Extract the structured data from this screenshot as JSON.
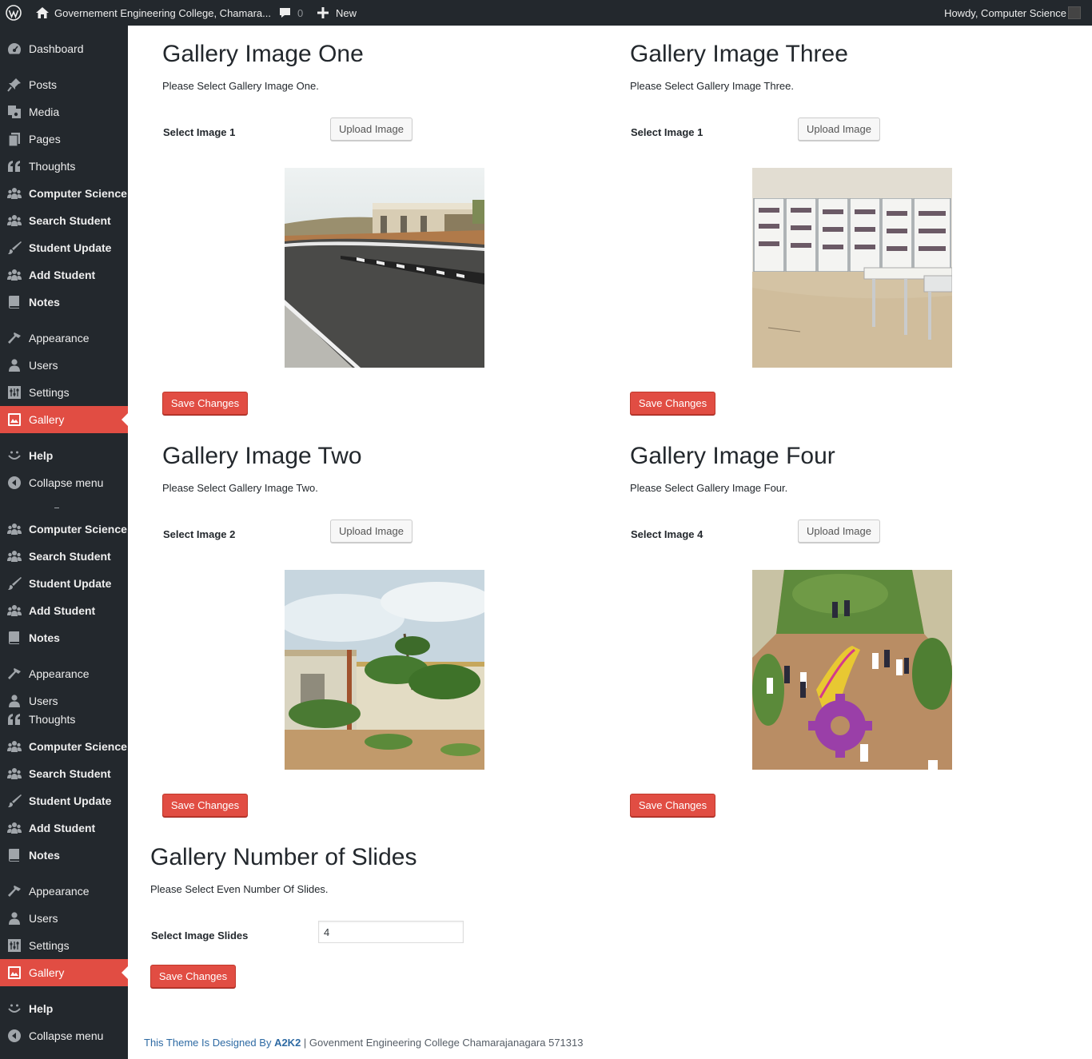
{
  "admin_bar": {
    "site_name": "Governement Engineering College, Chamara...",
    "comment_count": "0",
    "new_label": "New",
    "howdy": "Howdy, Computer Science"
  },
  "sidebar": {
    "items": [
      {
        "label": "Dashboard",
        "icon": "dashboard-icon",
        "bold": false
      },
      {
        "label": "Posts",
        "icon": "pushpin-icon",
        "bold": false
      },
      {
        "label": "Media",
        "icon": "media-icon",
        "bold": false
      },
      {
        "label": "Pages",
        "icon": "pages-icon",
        "bold": false
      },
      {
        "label": "Thoughts",
        "icon": "quote-icon",
        "bold": false
      },
      {
        "label": "Computer Science",
        "icon": "groups-icon",
        "bold": true
      },
      {
        "label": "Search Student",
        "icon": "groups-icon",
        "bold": true
      },
      {
        "label": "Student Update",
        "icon": "brush-icon",
        "bold": true
      },
      {
        "label": "Add Student",
        "icon": "groups-icon",
        "bold": true
      },
      {
        "label": "Notes",
        "icon": "book-icon",
        "bold": true
      },
      {
        "label": "Appearance",
        "icon": "hammer-icon",
        "bold": false
      },
      {
        "label": "Users",
        "icon": "user-icon",
        "bold": false
      },
      {
        "label": "Settings",
        "icon": "settings-icon",
        "bold": false
      },
      {
        "label": "Gallery",
        "icon": "gallery-icon",
        "bold": false,
        "active": true
      },
      {
        "label": "Help",
        "icon": "smiley-icon",
        "bold": true
      },
      {
        "label": "Collapse menu",
        "icon": "collapse-icon",
        "bold": false
      },
      {
        "label": "Computer Science",
        "icon": "groups-icon",
        "bold": true
      },
      {
        "label": "Search Student",
        "icon": "groups-icon",
        "bold": true
      },
      {
        "label": "Student Update",
        "icon": "brush-icon",
        "bold": true
      },
      {
        "label": "Add Student",
        "icon": "groups-icon",
        "bold": true
      },
      {
        "label": "Notes",
        "icon": "book-icon",
        "bold": true
      },
      {
        "label": "Appearance",
        "icon": "hammer-icon",
        "bold": false
      },
      {
        "label": "Users",
        "icon": "user-icon",
        "bold": false
      },
      {
        "label": "Thoughts",
        "icon": "quote-icon",
        "bold": false
      },
      {
        "label": "Computer Science",
        "icon": "groups-icon",
        "bold": true
      },
      {
        "label": "Search Student",
        "icon": "groups-icon",
        "bold": true
      },
      {
        "label": "Student Update",
        "icon": "brush-icon",
        "bold": true
      },
      {
        "label": "Add Student",
        "icon": "groups-icon",
        "bold": true
      },
      {
        "label": "Notes",
        "icon": "book-icon",
        "bold": true
      },
      {
        "label": "Appearance",
        "icon": "hammer-icon",
        "bold": false
      },
      {
        "label": "Users",
        "icon": "user-icon",
        "bold": false
      },
      {
        "label": "Settings",
        "icon": "settings-icon",
        "bold": false
      },
      {
        "label": "Gallery",
        "icon": "gallery-icon",
        "bold": false,
        "active": true
      },
      {
        "label": "Help",
        "icon": "smiley-icon",
        "bold": true
      },
      {
        "label": "Collapse menu",
        "icon": "collapse-icon",
        "bold": false
      }
    ]
  },
  "gallery": {
    "one": {
      "title": "Gallery Image One",
      "description": "Please Select Gallery Image One.",
      "field_label": "Select Image 1",
      "upload_label": "Upload Image",
      "save_label": "Save Changes"
    },
    "two": {
      "title": "Gallery Image Two",
      "description": "Please Select Gallery Image Two.",
      "field_label": "Select Image 2",
      "upload_label": "Upload Image",
      "save_label": "Save Changes"
    },
    "three": {
      "title": "Gallery Image Three",
      "description": "Please Select Gallery Image Three.",
      "field_label": "Select Image 1",
      "upload_label": "Upload Image",
      "save_label": "Save Changes"
    },
    "four": {
      "title": "Gallery Image Four",
      "description": "Please Select Gallery Image Four.",
      "field_label": "Select Image 4",
      "upload_label": "Upload Image",
      "save_label": "Save Changes"
    },
    "slides": {
      "title": "Gallery Number of Slides",
      "description": "Please Select Even Number Of Slides.",
      "field_label": "Select Image Slides",
      "value": "4",
      "save_label": "Save Changes"
    }
  },
  "footer": {
    "prefix": "This Theme Is Designed By ",
    "author": "A2K2",
    "suffix": " | Govenment Engineering College Chamarajanagara 571313"
  },
  "colors": {
    "sidebar_bg": "#23282d",
    "accent_red": "#e14d43",
    "link_blue": "#2e6aa3"
  }
}
